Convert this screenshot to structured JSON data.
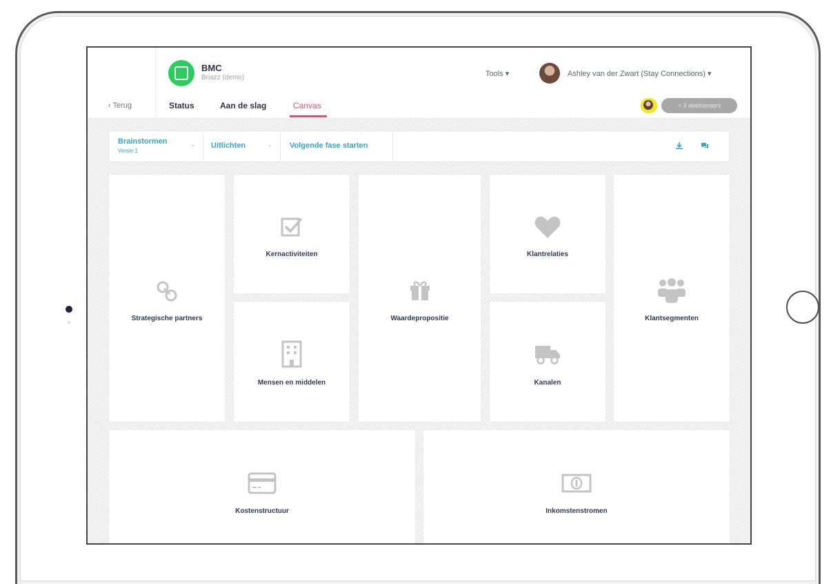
{
  "header": {
    "app_title": "BMC",
    "app_subtitle": "Briazz (demo)",
    "back_label": "‹ Terug",
    "tools_label": "Tools ▾",
    "user_name": "Ashley van der Zwart (Stay Connections) ▾",
    "share_label": "+ 3 deelnemers",
    "tabs": [
      {
        "label": "Status"
      },
      {
        "label": "Aan de slag"
      },
      {
        "label": "Canvas",
        "active": true
      }
    ]
  },
  "toolbar": {
    "phase_label": "Brainstormen",
    "phase_sub": "Versie 1",
    "mode_label": "Uitlichten",
    "next_phase_label": "Volgende fase starten",
    "caret": "⌄"
  },
  "canvas": {
    "blocks": [
      {
        "key": "strategic",
        "label": "Strategische partners",
        "icon": "link-icon"
      },
      {
        "key": "activities",
        "label": "Kernactiviteiten",
        "icon": "checkbox-icon"
      },
      {
        "key": "resources",
        "label": "Mensen en middelen",
        "icon": "building-icon"
      },
      {
        "key": "value",
        "label": "Waardepropositie",
        "icon": "gift-icon"
      },
      {
        "key": "relations",
        "label": "Klantrelaties",
        "icon": "heart-icon"
      },
      {
        "key": "channels",
        "label": "Kanalen",
        "icon": "truck-icon"
      },
      {
        "key": "segments",
        "label": "Klantsegmenten",
        "icon": "users-icon"
      },
      {
        "key": "costs",
        "label": "Kostenstructuur",
        "icon": "credit-card-icon"
      },
      {
        "key": "revenue",
        "label": "Inkomstenstromen",
        "icon": "banknote-icon"
      }
    ]
  },
  "colors": {
    "accent": "#3aa2c4",
    "active_tab": "#e44e6a",
    "logo": "#2ccc5e",
    "label_text": "#2e3b55",
    "icon_grey": "#c4c4c4"
  }
}
